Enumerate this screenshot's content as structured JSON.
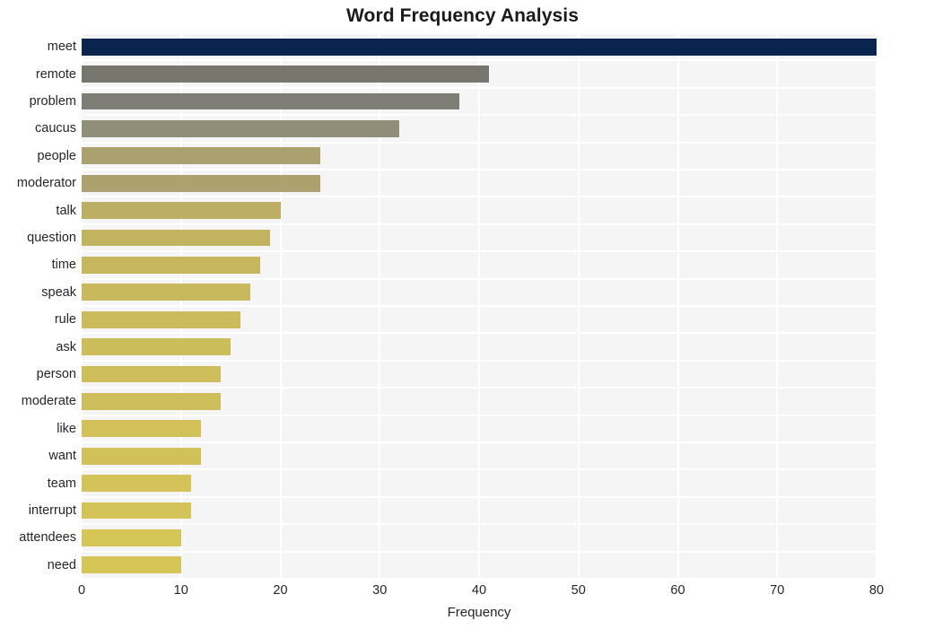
{
  "chart_data": {
    "type": "bar",
    "orientation": "horizontal",
    "title": "Word Frequency Analysis",
    "xlabel": "Frequency",
    "ylabel": "",
    "xlim": [
      0,
      80
    ],
    "xticks": [
      0,
      10,
      20,
      30,
      40,
      50,
      60,
      70,
      80
    ],
    "xtick_labels": [
      "0",
      "10",
      "20",
      "30",
      "40",
      "50",
      "60",
      "70",
      "80"
    ],
    "grid": true,
    "grid_color": "#ffffff",
    "plot_background": "#f5f5f5",
    "figure_background": "#ffffff",
    "legend": null,
    "categories": [
      "meet",
      "remote",
      "problem",
      "caucus",
      "people",
      "moderator",
      "talk",
      "question",
      "time",
      "speak",
      "rule",
      "ask",
      "person",
      "moderate",
      "like",
      "want",
      "team",
      "interrupt",
      "attendees",
      "need"
    ],
    "values": [
      80,
      41,
      38,
      32,
      24,
      24,
      20,
      19,
      18,
      17,
      16,
      15,
      14,
      14,
      12,
      12,
      11,
      11,
      10,
      10
    ],
    "bar_colors": [
      "#0a2450",
      "#77776f",
      "#7e7d76",
      "#908d78",
      "#aba170",
      "#ada26f",
      "#bcae65",
      "#c2b361",
      "#c6b75f",
      "#c9b95d",
      "#cbbb5c",
      "#ccbd5b",
      "#cebe5b",
      "#cebe5b",
      "#d2c159",
      "#d2c159",
      "#d4c358",
      "#d4c358",
      "#d6c557",
      "#d6c557"
    ],
    "series": [
      {
        "name": "Frequency",
        "points": [
          {
            "label": "meet",
            "value": 80,
            "color": "#0a2450"
          },
          {
            "label": "remote",
            "value": 41,
            "color": "#77776f"
          },
          {
            "label": "problem",
            "value": 38,
            "color": "#7e7d76"
          },
          {
            "label": "caucus",
            "value": 32,
            "color": "#908d78"
          },
          {
            "label": "people",
            "value": 24,
            "color": "#aba170"
          },
          {
            "label": "moderator",
            "value": 24,
            "color": "#ada26f"
          },
          {
            "label": "talk",
            "value": 20,
            "color": "#bcae65"
          },
          {
            "label": "question",
            "value": 19,
            "color": "#c2b361"
          },
          {
            "label": "time",
            "value": 18,
            "color": "#c6b75f"
          },
          {
            "label": "speak",
            "value": 17,
            "color": "#c9b95d"
          },
          {
            "label": "rule",
            "value": 16,
            "color": "#cbbb5c"
          },
          {
            "label": "ask",
            "value": 15,
            "color": "#ccbd5b"
          },
          {
            "label": "person",
            "value": 14,
            "color": "#cebe5b"
          },
          {
            "label": "moderate",
            "value": 14,
            "color": "#cebe5b"
          },
          {
            "label": "like",
            "value": 12,
            "color": "#d2c159"
          },
          {
            "label": "want",
            "value": 12,
            "color": "#d2c159"
          },
          {
            "label": "team",
            "value": 11,
            "color": "#d4c358"
          },
          {
            "label": "interrupt",
            "value": 11,
            "color": "#d4c358"
          },
          {
            "label": "attendees",
            "value": 10,
            "color": "#d6c557"
          },
          {
            "label": "need",
            "value": 10,
            "color": "#d6c557"
          }
        ]
      }
    ]
  }
}
